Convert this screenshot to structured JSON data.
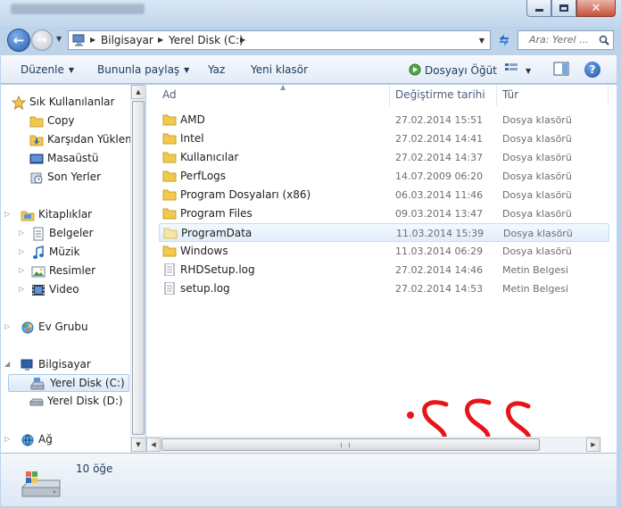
{
  "window": {
    "buttons": [
      "minimize",
      "maximize",
      "close"
    ]
  },
  "navigation": {
    "breadcrumbs": [
      "Bilgisayar",
      "Yerel Disk (C:)"
    ],
    "search_placeholder": "Ara: Yerel ...",
    "icons": [
      "back-arrow-icon",
      "forward-arrow-icon",
      "refresh-icon",
      "search-icon"
    ]
  },
  "toolbar": {
    "organize": "Düzenle",
    "share_with": "Bununla paylaş",
    "burn": "Yaz",
    "new_folder": "Yeni klasör",
    "play": "Dosyayı Öğüt",
    "help": "?"
  },
  "sidebar": {
    "favorites": {
      "label": "Sık Kullanılanlar",
      "items": [
        "Copy",
        "Karşıdan Yüklem",
        "Masaüstü",
        "Son Yerler"
      ]
    },
    "libraries": {
      "label": "Kitaplıklar",
      "items": [
        "Belgeler",
        "Müzik",
        "Resimler",
        "Video"
      ]
    },
    "homegroup": "Ev Grubu",
    "computer": {
      "label": "Bilgisayar",
      "items": [
        "Yerel Disk (C:)",
        "Yerel Disk (D:)"
      ]
    },
    "network": "Ağ"
  },
  "columns": {
    "name": "Ad",
    "date": "Değiştirme tarihi",
    "type": "Tür"
  },
  "files": [
    {
      "name": "AMD",
      "date": "27.02.2014 15:51",
      "type": "Dosya klasörü",
      "kind": "folder"
    },
    {
      "name": "Intel",
      "date": "27.02.2014 14:41",
      "type": "Dosya klasörü",
      "kind": "folder"
    },
    {
      "name": "Kullanıcılar",
      "date": "27.02.2014 14:37",
      "type": "Dosya klasörü",
      "kind": "folder"
    },
    {
      "name": "PerfLogs",
      "date": "14.07.2009 06:20",
      "type": "Dosya klasörü",
      "kind": "folder"
    },
    {
      "name": "Program Dosyaları (x86)",
      "date": "06.03.2014 11:46",
      "type": "Dosya klasörü",
      "kind": "folder"
    },
    {
      "name": "Program Files",
      "date": "09.03.2014 13:47",
      "type": "Dosya klasörü",
      "kind": "folder"
    },
    {
      "name": "ProgramData",
      "date": "11.03.2014 15:39",
      "type": "Dosya klasörü",
      "kind": "folder-light"
    },
    {
      "name": "Windows",
      "date": "11.03.2014 06:29",
      "type": "Dosya klasörü",
      "kind": "folder"
    },
    {
      "name": "RHDSetup.log",
      "date": "27.02.2014 14:46",
      "type": "Metin Belgesi",
      "kind": "text"
    },
    {
      "name": "setup.log",
      "date": "27.02.2014 14:53",
      "type": "Metin Belgesi",
      "kind": "text"
    }
  ],
  "annotation": {
    "color": "#e8141a"
  },
  "status": {
    "count": "10 öğe"
  },
  "colors": {
    "folder": "#f2c94c",
    "accent": "#1e395b",
    "selection": "#d9e8f8"
  }
}
